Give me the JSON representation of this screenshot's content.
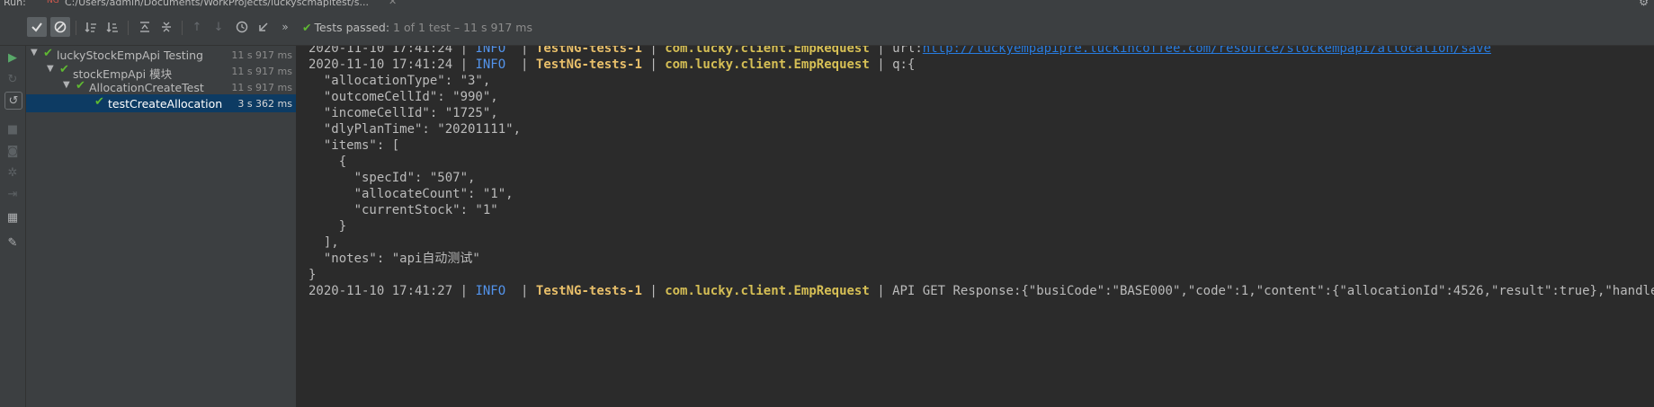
{
  "window": {
    "run_label": "Run:",
    "tab_icon": "testng-icon",
    "tab_icon_text": "NG",
    "tab_title": "C:/Users/admin/Documents/WorkProjects/luckyscmapitest/s..."
  },
  "toolbar": {
    "status_prefix": "Tests passed:",
    "status_count": "1 of 1 test – 11 s 917 ms"
  },
  "tree": [
    {
      "name": "luckyStockEmpApi Testing",
      "duration": "11 s 917 ms"
    },
    {
      "name": "stockEmpApi 模块",
      "duration": "11 s 917 ms"
    },
    {
      "name": "AllocationCreateTest",
      "duration": "11 s 917 ms"
    },
    {
      "name": "testCreateAllocation",
      "duration": "3 s 362 ms"
    }
  ],
  "console": {
    "log1": {
      "ts": "2020-11-10 17:41:24",
      "level": "INFO",
      "thread": "TestNG-tests-1",
      "cls": "com.lucky.client.EmpRequest",
      "prefix": "url:",
      "link": "http://luckyempapipre.luckincoffee.com/resource/stockempapi/allocation/save"
    },
    "log2": {
      "ts": "2020-11-10 17:41:24",
      "level": "INFO",
      "thread": "TestNG-tests-1",
      "cls": "com.lucky.client.EmpRequest",
      "msg": "q:{"
    },
    "body": [
      "  \"allocationType\": \"3\",",
      "  \"outcomeCellId\": \"990\",",
      "  \"incomeCellId\": \"1725\",",
      "  \"dlyPlanTime\": \"20201111\",",
      "  \"items\": [",
      "    {",
      "      \"specId\": \"507\",",
      "      \"allocateCount\": \"1\",",
      "      \"currentStock\": \"1\"",
      "    }",
      "  ],",
      "  \"notes\": \"api自动测试\"",
      "}"
    ],
    "log3": {
      "ts": "2020-11-10 17:41:27",
      "level": "INFO",
      "thread": "TestNG-tests-1",
      "cls": "com.lucky.client.EmpRequest",
      "msg": "API GET Response:{\"busiCode\":\"BASE000\",\"code\":1,\"content\":{\"allocationId\":4526,\"result\":true},\"handler\":\"CLIEN"
    }
  },
  "colors": {
    "bg": "#2b2b2b",
    "panel": "#3c3f41",
    "selection": "#0d3b63",
    "pass_green": "#5fb832",
    "info_blue": "#5394ec",
    "thread_yellow": "#e8bf6a",
    "link_blue": "#287bde"
  }
}
